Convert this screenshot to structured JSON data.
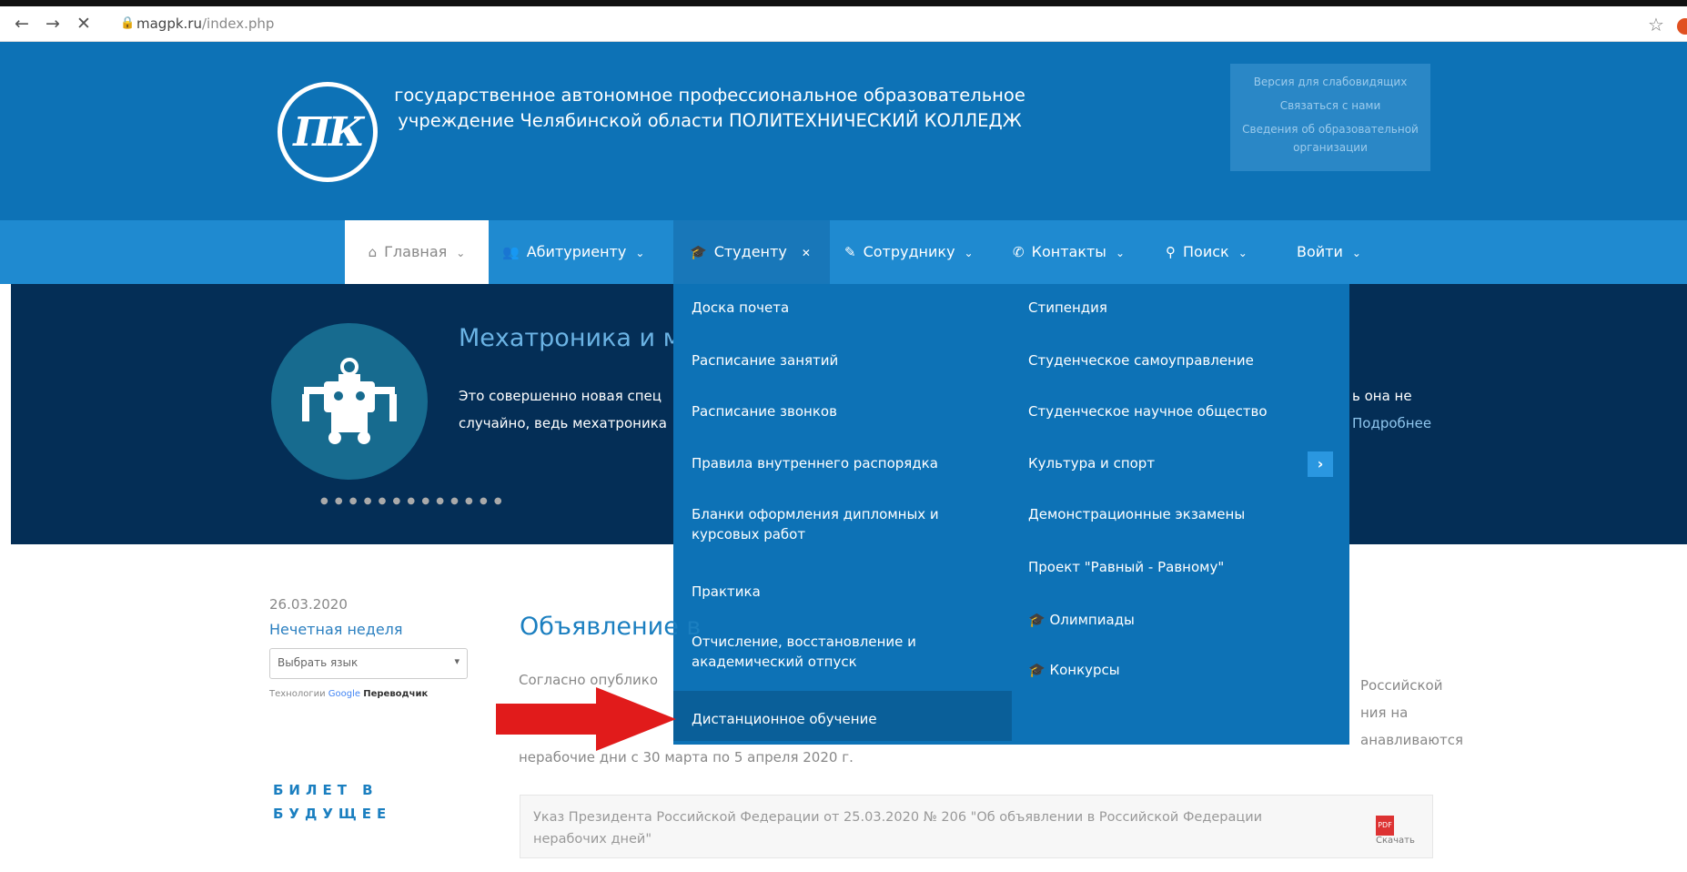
{
  "browser": {
    "url_host": "magpk.ru",
    "url_path": "/index.php"
  },
  "header": {
    "logo_text": "ПК",
    "org_name_line1": "государственное автономное профессиональное образовательное",
    "org_name_line2": "учреждение Челябинской области ПОЛИТЕХНИЧЕСКИЙ КОЛЛЕДЖ",
    "info_links": [
      "Версия для слабовидящих",
      "Связаться с нами",
      "Сведения об образовательной организации"
    ]
  },
  "menu": {
    "items": [
      "Главная",
      "Абитуриенту",
      "Студенту",
      "Сотруднику",
      "Контакты",
      "Поиск",
      "Войти"
    ]
  },
  "dropdown": {
    "col1": [
      "Доска почета",
      "Расписание занятий",
      "Расписание звонков",
      "Правила внутреннего распорядка",
      "Бланки оформления дипломных и курсовых работ",
      "Практика",
      "Отчисление, восстановление и академический отпуск",
      "Дистанционное обучение"
    ],
    "col2": [
      "Стипендия",
      "Студенческое самоуправление",
      "Студенческое научное общество",
      "Культура и спорт",
      "Демонстрационные экзамены",
      "Проект \"Равный - Равному\"",
      "Олимпиады",
      "Конкурсы"
    ]
  },
  "slider": {
    "title": "Мехатроника и моб",
    "text_left": "Это совершенно новая спец случайно, ведь мехатроника",
    "text_right": "ь она не",
    "more": "Подробнее"
  },
  "sidebar": {
    "date": "26.03.2020",
    "week": "Нечетная неделя",
    "lang_select": "Выбрать язык",
    "google_prefix": "Технологии",
    "google_word": "Google",
    "google_suffix": "Переводчик",
    "bilet_line1": "БИЛЕТ В",
    "bilet_line2": "БУДУЩЕЕ"
  },
  "main": {
    "announcement_title": "Объявление в",
    "body_left": "Согласно опублико",
    "body_right_1": "Российской",
    "body_right_2": "ния на",
    "body_right_3": "анавливаются",
    "body_bottom": "нерабочие дни с 30 марта по 5 апреля 2020 г.",
    "doc_text": "Указ Президента Российской Федерации от 25.03.2020 № 206 \"Об объявлении в Российской Федерации нерабочих дней\"",
    "doc_download": "Скачать"
  }
}
